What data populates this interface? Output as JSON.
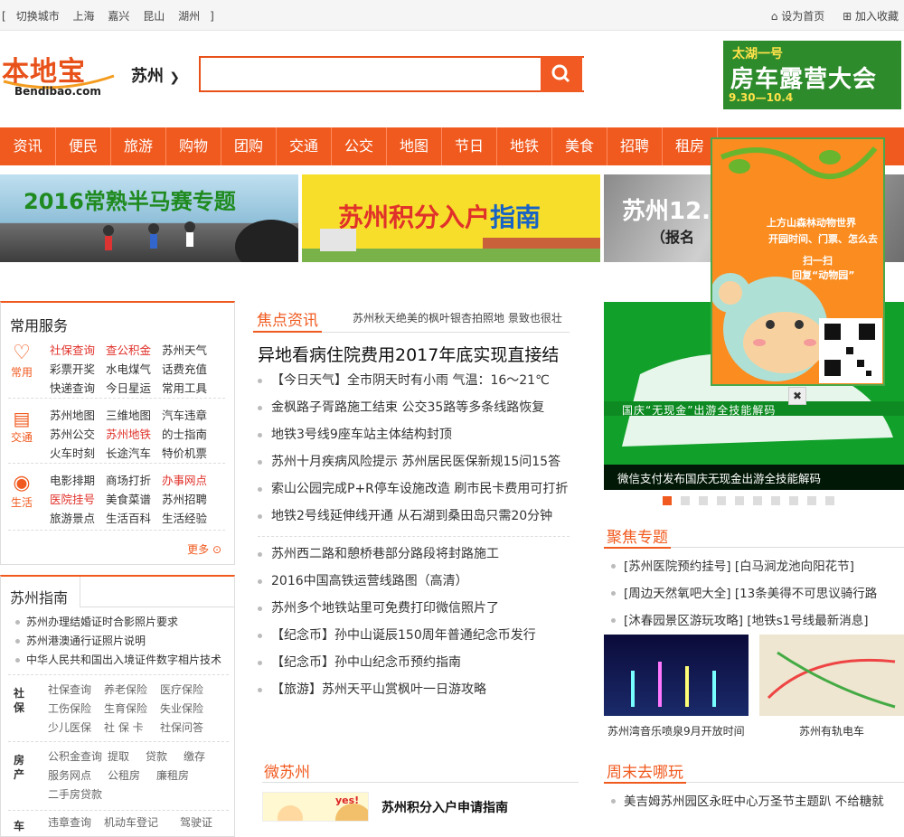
{
  "topbar": {
    "switch_city": "切换城市",
    "cities": [
      "上海",
      "嘉兴",
      "昆山",
      "湖州"
    ],
    "bracket_open": "[",
    "bracket_close": "]",
    "set_home": "设为首页",
    "add_favorite": "加入收藏"
  },
  "header": {
    "logo_cn": "本地宝",
    "logo_en": "Bendibao.com",
    "city": "苏州",
    "search_placeholder": "",
    "ad": {
      "line1": "太湖一号",
      "line2": "房车露营大会",
      "line3": "9.30—10.4"
    }
  },
  "nav": [
    "资讯",
    "便民",
    "旅游",
    "购物",
    "团购",
    "交通",
    "公交",
    "地图",
    "节日",
    "地铁",
    "美食",
    "招聘",
    "租房"
  ],
  "banners": [
    {
      "text": "2016常熟半马赛专题"
    },
    {
      "text_a": "苏州积分入户",
      "text_b": "指南"
    },
    {
      "text": "苏州12.4",
      "sub": "（报名"
    }
  ],
  "services": {
    "title": "常用服务",
    "groups": [
      {
        "icon_label": "常用",
        "icon": "heart-icon",
        "links": [
          [
            "社保查询",
            "查公积金",
            "苏州天气"
          ],
          [
            "彩票开奖",
            "水电煤气",
            "话费充值"
          ],
          [
            "快递查询",
            "今日星运",
            "常用工具"
          ]
        ],
        "red": [
          0,
          1
        ]
      },
      {
        "icon_label": "交通",
        "icon": "traffic-light-icon",
        "links": [
          [
            "苏州地图",
            "三维地图",
            "汽车违章"
          ],
          [
            "苏州公交",
            "苏州地铁",
            "的士指南"
          ],
          [
            "火车时刻",
            "长途汽车",
            "特价机票"
          ]
        ],
        "red": [
          4
        ]
      },
      {
        "icon_label": "生活",
        "icon": "life-ring-icon",
        "links": [
          [
            "电影排期",
            "商场打折",
            "办事网点"
          ],
          [
            "医院挂号",
            "美食菜谱",
            "苏州招聘"
          ],
          [
            "旅游景点",
            "生活百科",
            "生活经验"
          ]
        ],
        "red": [
          2,
          3
        ]
      }
    ],
    "more": "更多"
  },
  "guide": {
    "title": "苏州指南",
    "items": [
      "苏州办理结婚证时合影照片要求",
      "苏州港澳通行证照片说明",
      "中华人民共和国出入境证件数字相片技术"
    ],
    "social": {
      "label_a": "社",
      "label_b": "保",
      "links": [
        [
          "社保查询",
          "养老保险",
          "医疗保险"
        ],
        [
          "工伤保险",
          "生育保险",
          "失业保险"
        ],
        [
          "少儿医保",
          "社 保 卡",
          "社保问答"
        ]
      ]
    },
    "housing": {
      "label_a": "房",
      "label_b": "产",
      "links": [
        [
          "公积金查询",
          "提取",
          "贷款",
          "缴存"
        ],
        [
          "服务网点",
          "公租房",
          "廉租房"
        ],
        [
          "二手房贷款"
        ]
      ]
    },
    "car": {
      "label": "车",
      "links": [
        "违章查询",
        "机动车登记",
        "驾驶证"
      ]
    }
  },
  "focus_news": {
    "title": "焦点资讯",
    "ticker": "苏州秋天绝美的枫叶银杏拍照地 景致也很壮",
    "headline": "异地看病住院费用2017年底实现直接结",
    "list1": [
      "【今日天气】全市阴天时有小雨 气温：16～21℃",
      "金枫路子胥路施工结束 公交35路等多条线路恢复",
      "地铁3号线9座车站主体结构封顶",
      "苏州十月疾病风险提示 苏州居民医保新规15问15答",
      "索山公园完成P+R停车设施改造 刷市民卡费用可打折",
      "地铁2号线延伸线开通 从石湖到桑田岛只需20分钟"
    ],
    "list2": [
      "苏州西二路和憩桥巷部分路段将封路施工",
      "2016中国高铁运营线路图（高清）",
      "苏州多个地铁站里可免费打印微信照片了",
      "【纪念币】孙中山诞辰150周年普通纪念币发行",
      "【纪念币】孙中山纪念币预约指南",
      "【旅游】苏州天平山赏枫叶一日游攻略"
    ]
  },
  "wechat": {
    "title": "微苏州",
    "item": "苏州积分入户申请指南",
    "bubble": "yes!"
  },
  "slider": {
    "caption": "微信支付发布国庆无现金出游全技能解码",
    "banner_text": "国庆“无现金”出游全技能解码",
    "dots": 10,
    "active": 0
  },
  "popup": {
    "title": "上方山森林动物世界",
    "subtitle": "开园时间、门票、怎么去",
    "scan": "扫一扫",
    "reply": "回复“动物园”",
    "close": "✖"
  },
  "topics": {
    "title": "聚焦专题",
    "items": [
      "[苏州医院预约挂号] [白马涧龙池向阳花节]",
      "[周边天然氧吧大全] [13条美得不可思议骑行路",
      "[沐春园景区游玩攻略] [地铁s1号线最新消息]"
    ],
    "photos": [
      {
        "caption": "苏州湾音乐喷泉9月开放时间"
      },
      {
        "caption": "苏州有轨电车"
      }
    ]
  },
  "weekend": {
    "title": "周末去哪玩",
    "item": "美吉姆苏州园区永旺中心万圣节主题趴 不给糖就"
  },
  "colors": {
    "brand": "#f05a1f",
    "nav": "#f05a1f",
    "red_link": "#e0312a"
  }
}
